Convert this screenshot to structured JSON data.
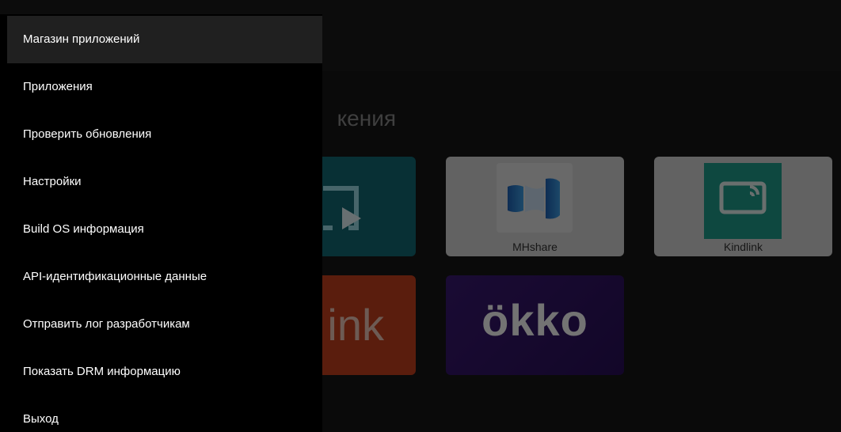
{
  "menu": {
    "items": [
      {
        "label": "Магазин приложений",
        "active": true
      },
      {
        "label": "Приложения"
      },
      {
        "label": "Проверить обновления"
      },
      {
        "label": "Настройки"
      },
      {
        "label": "Build OS информация"
      },
      {
        "label": "API-идентификационные данные"
      },
      {
        "label": "Отправить лог разработчикам"
      },
      {
        "label": "Показать DRM информацию"
      },
      {
        "label": "Выход"
      }
    ]
  },
  "background": {
    "section_title_visible": "кения",
    "tiles": {
      "mhshare_label": "MHshare",
      "kindlink_label": "Kindlink",
      "red_tile_text": "ink",
      "okko_text": "ökko"
    }
  },
  "colors": {
    "menu_bg": "#000000",
    "menu_active_bg": "#202020",
    "teal": "#126a76",
    "red": "#c8411e",
    "okko_purple": "#3a1a73"
  }
}
